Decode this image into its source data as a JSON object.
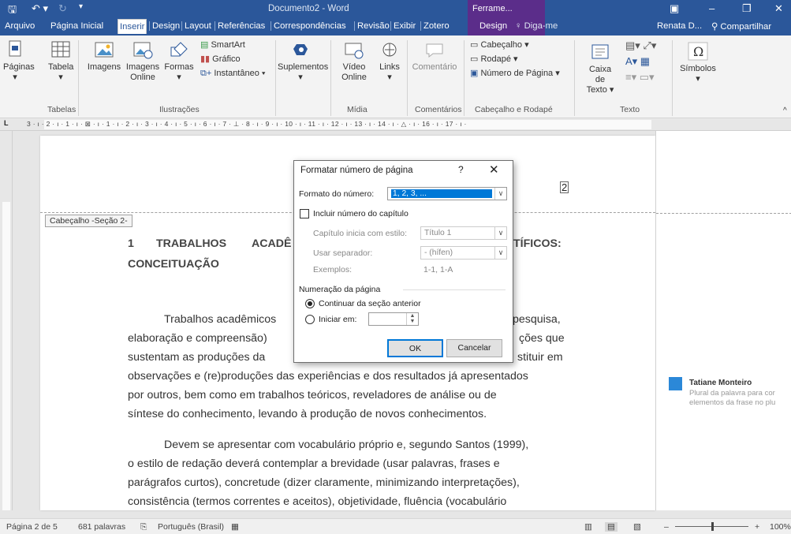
{
  "window": {
    "title": "Documento2 - Word",
    "context_header": "Ferrame..."
  },
  "tabs": [
    {
      "label": "Arquivo"
    },
    {
      "label": "Página Inicial"
    },
    {
      "label": "Inserir"
    },
    {
      "label": "Design"
    },
    {
      "label": "Layout"
    },
    {
      "label": "Referências"
    },
    {
      "label": "Correspondências"
    },
    {
      "label": "Revisão"
    },
    {
      "label": "Exibir"
    },
    {
      "label": "Zotero"
    },
    {
      "label": "Design"
    },
    {
      "label": "Diga-me"
    }
  ],
  "user": {
    "name": "Renata D...",
    "share": "Compartilhar"
  },
  "ribbon": {
    "paginas": "Páginas",
    "tabela": "Tabela",
    "imagens": "Imagens",
    "imagens_online_1": "Imagens",
    "imagens_online_2": "Online",
    "formas": "Formas",
    "smartart": "SmartArt",
    "grafico": "Gráfico",
    "instantaneo": "Instantâneo",
    "suplementos": "Suplementos",
    "video_1": "Vídeo",
    "video_2": "Online",
    "links": "Links",
    "comentario": "Comentário",
    "cabecalho": "Cabeçalho",
    "rodape": "Rodapé",
    "numero_pagina": "Número de Página",
    "caixa_texto_1": "Caixa de",
    "caixa_texto_2": "Texto",
    "simbolos": "Símbolos",
    "groups": {
      "tabelas": "Tabelas",
      "ilustracoes": "Ilustrações",
      "midia": "Mídia",
      "comentarios": "Comentários",
      "cab_rod": "Cabeçalho e Rodapé",
      "texto": "Texto"
    }
  },
  "ruler": "3 · ı · 2 · ı · 1 · ı · ⊠ · ı · 1 · ı · 2 · ı · 3 · ı · 4 · ı · 5 · ı · 6 · ı · 7 · ⊥ · 8 · ı · 9 · ı · 10 · ı · 11 · ı · 12 · ı · 13 · ı · 14 · ı · △ · ı · 16 · ı · 17 · ı ·",
  "document": {
    "page_number": "2",
    "header_label": "Cabeçalho -Seção 2-",
    "heading_num": "1",
    "heading_w1": "TRABALHOS",
    "heading_w2": "ACADÊ",
    "heading_w3": "TÍFICOS:",
    "heading_line2": "CONCEITUAÇÃO",
    "p1_l1a": "Trabalhos acadêmicos",
    "p1_l1b": "pesquisa,",
    "p1_l2a": "elaboração e compreensão)",
    "p1_l2b": "ções que",
    "p1_l3a": "sustentam as produções da",
    "p1_l3b": "stituir em",
    "p1_l4": "observações e (re)produções das experiências e dos resultados já apresentados",
    "p1_l5": "por outros, bem como em trabalhos teóricos, reveladores de análise ou de",
    "p1_l6": "síntese do conhecimento, levando à produção de novos conhecimentos.",
    "p2_l1": "Devem se apresentar com vocabulário próprio e, segundo Santos (1999),",
    "p2_l2": "o estilo de redação deverá contemplar a brevidade (usar palavras, frases e",
    "p2_l3": "parágrafos curtos), concretude (dizer claramente, minimizando interpretações),",
    "p2_l4": "consistência (termos correntes e aceitos), objetividade, fluência (vocabulário"
  },
  "comment": {
    "author": "Tatiane Monteiro",
    "line1": "Plural da palavra para cor",
    "line2": "elementos da frase no plu"
  },
  "dialog": {
    "title": "Formatar número de página",
    "help": "?",
    "close": "✕",
    "formato_label": "Formato do número:",
    "formato_value": "1, 2, 3, ...",
    "incluir_label": "Incluir número do capítulo",
    "capitulo_label": "Capítulo inicia com estilo:",
    "capitulo_value": "Título 1",
    "separador_label": "Usar separador:",
    "separador_value": "-   (hífen)",
    "exemplos_label": "Exemplos:",
    "exemplos_value": "1-1, 1-A",
    "numeracao_label": "Numeração da página",
    "continuar_label": "Continuar da seção anterior",
    "iniciar_label": "Iniciar em:",
    "iniciar_value": "",
    "ok": "OK",
    "cancelar": "Cancelar"
  },
  "status": {
    "page": "Página 2 de 5",
    "words": "681 palavras",
    "language": "Português (Brasil)",
    "zoom": "100%"
  }
}
